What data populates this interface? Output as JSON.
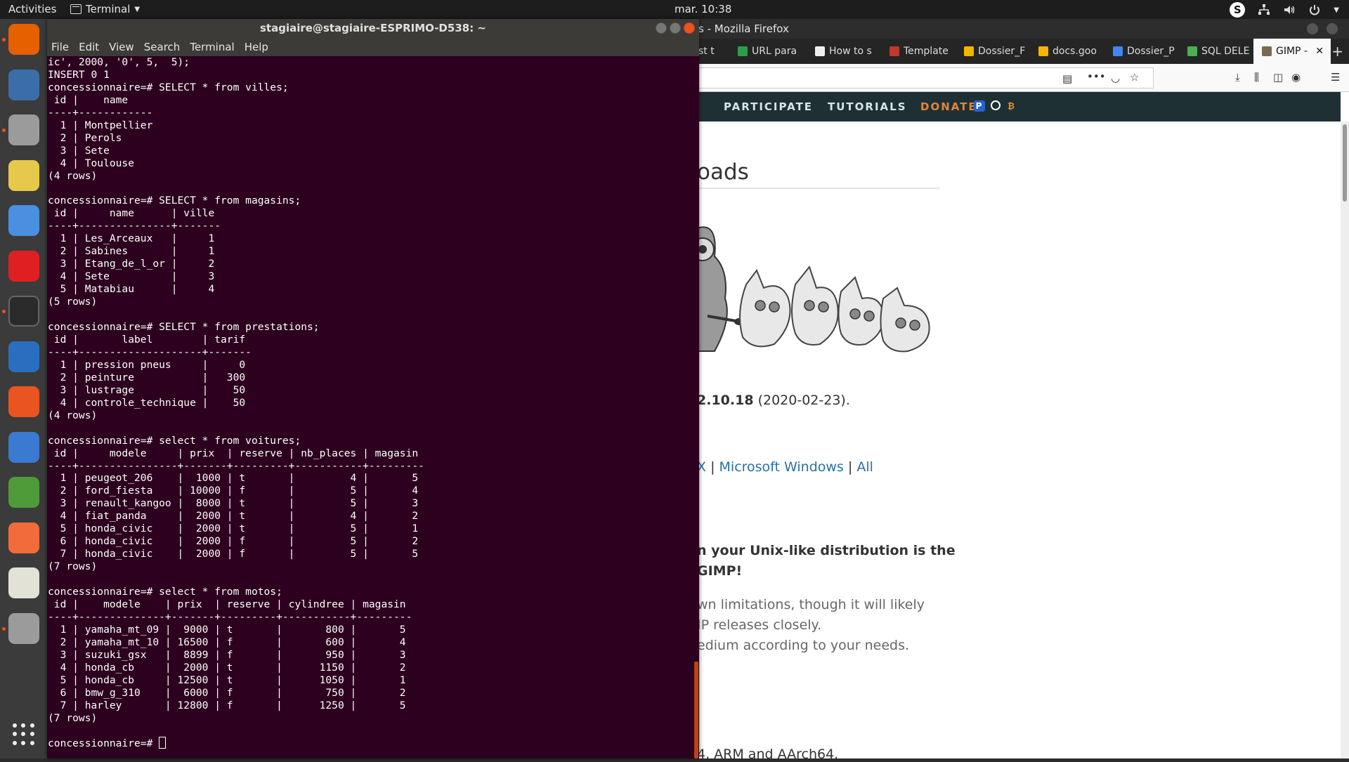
{
  "topbar": {
    "activities": "Activities",
    "app_name": "Terminal",
    "clock": "mar. 10:38",
    "skype_letter": "S"
  },
  "dock": {
    "apps": [
      {
        "name": "firefox",
        "color": "#e66000",
        "running": true
      },
      {
        "name": "thunderbird",
        "color": "#3b6ea8",
        "running": false
      },
      {
        "name": "files",
        "color": "#9b9b9b",
        "running": true
      },
      {
        "name": "rhythmbox",
        "color": "#e6c84a",
        "running": false
      },
      {
        "name": "chromium",
        "color": "#4a8fe0",
        "running": false
      },
      {
        "name": "youtube-music",
        "color": "#e02020",
        "running": false
      },
      {
        "name": "terminal",
        "color": "#2b2b2b",
        "running": true
      },
      {
        "name": "libreoffice-writer",
        "color": "#2a6fbf",
        "running": false
      },
      {
        "name": "software-center",
        "color": "#e95420",
        "running": false
      },
      {
        "name": "help",
        "color": "#3a7ad0",
        "running": false
      },
      {
        "name": "spring-tools",
        "color": "#4f9b3a",
        "running": false
      },
      {
        "name": "postman",
        "color": "#f26b3a",
        "running": false
      },
      {
        "name": "text-editor",
        "color": "#e2e2d6",
        "running": false
      },
      {
        "name": "files-2",
        "color": "#9b9b9b",
        "running": true
      }
    ]
  },
  "terminal": {
    "title": "stagiaire@stagiaire-ESPRIMO-D538: ~",
    "menu": [
      "File",
      "Edit",
      "View",
      "Search",
      "Terminal",
      "Help"
    ],
    "lines": [
      "ic', 2000, '0', 5,  5);",
      "INSERT 0 1",
      "concessionnaire=# SELECT * from villes;",
      " id |    name    ",
      "----+------------",
      "  1 | Montpellier",
      "  2 | Perols",
      "  3 | Sete",
      "  4 | Toulouse",
      "(4 rows)",
      "",
      "concessionnaire=# SELECT * from magasins;",
      " id |     name      | ville ",
      "----+---------------+-------",
      "  1 | Les_Arceaux   |     1",
      "  2 | Sabines       |     1",
      "  3 | Etang_de_l_or |     2",
      "  4 | Sete          |     3",
      "  5 | Matabiau      |     4",
      "(5 rows)",
      "",
      "concessionnaire=# SELECT * from prestations;",
      " id |       label        | tarif ",
      "----+--------------------+-------",
      "  1 | pression pneus     |     0",
      "  2 | peinture           |   300",
      "  3 | lustrage           |    50",
      "  4 | controle_technique |    50",
      "(4 rows)",
      "",
      "concessionnaire=# select * from voitures;",
      " id |     modele     | prix  | reserve | nb_places | magasin ",
      "----+----------------+-------+---------+-----------+---------",
      "  1 | peugeot_206    |  1000 | t       |         4 |       5",
      "  2 | ford_fiesta    | 10000 | f       |         5 |       4",
      "  3 | renault_kangoo |  8000 | t       |         5 |       3",
      "  4 | fiat_panda     |  2000 | t       |         4 |       2",
      "  5 | honda_civic    |  2000 | t       |         5 |       1",
      "  6 | honda_civic    |  2000 | f       |         5 |       2",
      "  7 | honda_civic    |  2000 | f       |         5 |       5",
      "(7 rows)",
      "",
      "concessionnaire=# select * from motos;",
      " id |    modele    | prix  | reserve | cylindree | magasin ",
      "----+--------------+-------+---------+-----------+---------",
      "  1 | yamaha_mt_09 |  9000 | t       |       800 |       5",
      "  2 | yamaha_mt_10 | 16500 | f       |       600 |       4",
      "  3 | suzuki_gsx   |  8899 | f       |       950 |       3",
      "  4 | honda_cb     |  2000 | t       |      1150 |       2",
      "  5 | honda_cb     | 12500 | t       |      1050 |       1",
      "  6 | bmw_g_310    |  6000 | f       |       750 |       2",
      "  7 | harley       | 12800 | f       |      1250 |       5",
      "(7 rows)",
      ""
    ],
    "prompt": "concessionnaire=# "
  },
  "firefox": {
    "title": "s - Mozilla Firefox",
    "tabs": [
      {
        "label": "st t",
        "fav": "#888888",
        "active": false
      },
      {
        "label": "URL para",
        "fav": "#2e9d4a",
        "active": false
      },
      {
        "label": "How to s",
        "fav": "#eeeeee",
        "active": false
      },
      {
        "label": "Template",
        "fav": "#c0392b",
        "active": false
      },
      {
        "label": "Dossier_F",
        "fav": "#f4b400",
        "active": false
      },
      {
        "label": "docs.goo",
        "fav": "#f4b400",
        "active": false
      },
      {
        "label": "Dossier_P",
        "fav": "#4285f4",
        "active": false
      },
      {
        "label": "SQL DELE",
        "fav": "#4caf50",
        "active": false
      },
      {
        "label": "GIMP -",
        "fav": "#7a6a55",
        "active": true
      }
    ],
    "nav": [
      "PARTICIPATE",
      "TUTORIALS",
      "DONATE"
    ],
    "page": {
      "heading_fragment": "oads",
      "version_bold": "2.10.18",
      "version_date": " (2020-02-23).",
      "os_x": "X",
      "sep": " | ",
      "os_windows": "Microsoft Windows",
      "os_all": "All",
      "bold_line1": "n your Unix-like distribution is the",
      "bold_line2": "GIMP!",
      "para_line1": "wn limitations, though it will likely",
      "para_line2": "IP releases closely.",
      "para_line3": "edium according to your needs.",
      "arch_line": "4, ARM and AArch64."
    }
  }
}
